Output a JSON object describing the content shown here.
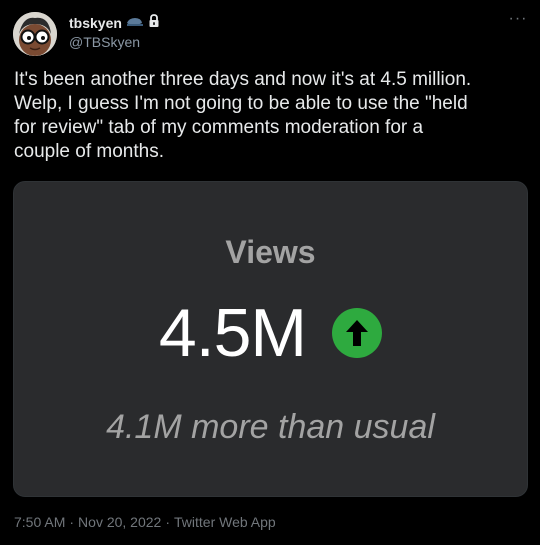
{
  "user": {
    "display_name": "tbskyen",
    "handle": "@TBSkyen",
    "avatar_icon": "cartoon-face-with-glasses",
    "badge_icons": [
      "whale-emoji-icon",
      "lock-icon"
    ]
  },
  "menu": {
    "more_label": "···"
  },
  "tweet": {
    "text": "It's been another three days and now it's at 4.5 million.\nWelp, I guess I'm not going to be able to use the \"held\nfor review\" tab of my comments moderation for a\ncouple of months."
  },
  "media": {
    "label": "Views",
    "value": "4.5M",
    "trend_icon": "arrow-up-icon",
    "trend_color": "#2eaa3f",
    "subtext": "4.1M more than usual"
  },
  "meta": {
    "time": "7:50 AM",
    "date": "Nov 20, 2022",
    "source": "Twitter Web App",
    "separator": "·"
  },
  "colors": {
    "background": "#000000",
    "text": "#e7e9ea",
    "muted": "#71767b",
    "card": "#2a2b2d"
  }
}
